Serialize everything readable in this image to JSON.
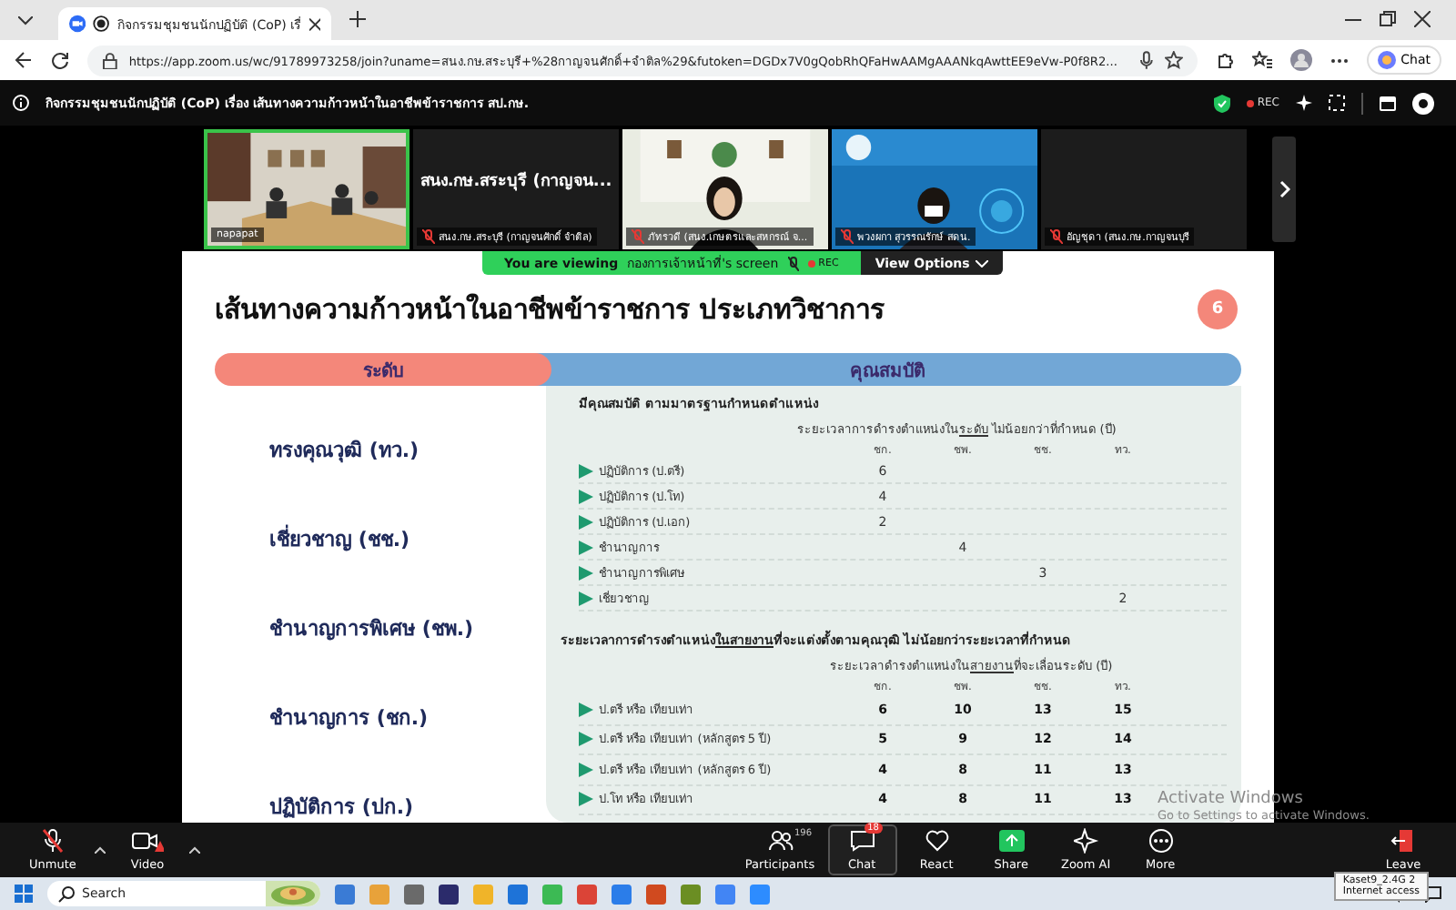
{
  "browser": {
    "tab_title": "กิจกรรมชุมชนนักปฏิบัติ (CoP) เรื่",
    "url": "https://app.zoom.us/wc/91789973258/join?uname=สนง.กษ.สระบุรี+%28กาญจนศักดิ์+จำติล%29&futoken=DGDx7V0gQobRhQFaHwAAMgAAANkqAwttEE9eVw-P0f8R2...",
    "chat_label": "Chat"
  },
  "meeting": {
    "title": "กิจกรรมชุมชนนักปฏิบัติ (CoP) เรื่อง เส้นทางความก้าวหน้าในอาชีพข้าราชการ สป.กษ.",
    "recording_label": "REC"
  },
  "participants": [
    {
      "name": "napapat",
      "muted": false,
      "active_speaker": true,
      "video": true
    },
    {
      "name": "สนง.กษ.สระบุรี (กาญจนศักดิ์ จำติล)",
      "display_name": "สนง.กษ.สระบุรี (กาญจน...",
      "muted": true,
      "active_speaker": false,
      "video": false
    },
    {
      "name": "ภัทรวดี (สนง.เกษตรและสหกรณ์ จ...",
      "muted": true,
      "active_speaker": false,
      "video": true
    },
    {
      "name": "พวงผกา สุวรรณรักษ์ สดน.",
      "muted": true,
      "active_speaker": false,
      "video": true
    },
    {
      "name": "อัญชุดา (สนง.กษ.กาญจนบุรี",
      "muted": true,
      "active_speaker": false,
      "video": false
    }
  ],
  "banner": {
    "prefix": "You are viewing",
    "sharer": "กองการเจ้าหน้าที่'s screen",
    "recording_label": "REC",
    "view_options": "View Options"
  },
  "slide": {
    "title": "เส้นทางความก้าวหน้าในอาชีพข้าราชการ ประเภทวิชาการ",
    "page_number": "6",
    "level_header": "ระดับ",
    "qualification_header": "คุณสมบัติ",
    "levels": [
      "ทรงคุณวุฒิ (ทว.)",
      "เชี่ยวชาญ (ชช.)",
      "ชำนาญการพิเศษ (ชพ.)",
      "ชำนาญการ (ชก.)",
      "ปฏิบัติการ (ปก.)"
    ],
    "sections": [
      {
        "heading": {
          "before": "มีคุณสมบัติ ตามมาตรฐานกำหนดตำแหน่ง"
        },
        "subheading": {
          "before": "ระยะเวลาการดำรงตำแหน่งใน",
          "underlined": "ระดับ",
          "after": " ไม่น้อยกว่าที่กำหนด (ปี)"
        },
        "columns": [
          "ชก.",
          "ชพ.",
          "ชช.",
          "ทว."
        ],
        "bold_values": false,
        "rows": [
          {
            "label": "ปฏิบัติการ (ป.ตรี)",
            "column_1": "6"
          },
          {
            "label": "ปฏิบัติการ (ป.โท)",
            "column_1": "4"
          },
          {
            "label": "ปฏิบัติการ (ป.เอก)",
            "column_1": "2"
          },
          {
            "label": "ชำนาญการ",
            "column_2": "4"
          },
          {
            "label": "ชำนาญการพิเศษ",
            "column_3": "3"
          },
          {
            "label": "เชี่ยวชาญ",
            "column_4": "2"
          }
        ]
      },
      {
        "heading": {
          "before": "ระยะเวลาการดำรงตำแหน่ง",
          "underlined": "ในสายงาน",
          "after": "ที่จะแต่งตั้งตามคุณวุฒิ ไม่น้อยกว่าระยะเวลาที่กำหนด"
        },
        "subheading": {
          "before": "ระยะเวลาดำรงตำแหน่งใน",
          "underlined": "สายงาน",
          "after": "ที่จะเลื่อนระดับ (ปี)"
        },
        "columns": [
          "ชก.",
          "ชพ.",
          "ชช.",
          "ทว."
        ],
        "bold_values": true,
        "rows": [
          {
            "label": "ป.ตรี หรือ เทียบเท่า",
            "column_1": "6",
            "column_2": "10",
            "column_3": "13",
            "column_4": "15"
          },
          {
            "label": "ป.ตรี หรือ เทียบเท่า (หลักสูตร 5 ปี)",
            "column_1": "5",
            "column_2": "9",
            "column_3": "12",
            "column_4": "14"
          },
          {
            "label": "ป.ตรี หรือ เทียบเท่า (หลักสูตร 6 ปี)",
            "column_1": "4",
            "column_2": "8",
            "column_3": "11",
            "column_4": "13"
          },
          {
            "label": "ป.โท หรือ เทียบเท่า",
            "column_1": "4",
            "column_2": "8",
            "column_3": "11",
            "column_4": "13"
          }
        ]
      }
    ]
  },
  "os_notice": [
    "Activate Windows",
    "Go to Settings to activate Windows."
  ],
  "toolbar": [
    {
      "kind": "mic",
      "label": "Unmute"
    },
    {
      "kind": "video",
      "label": "Video"
    },
    {
      "kind": "participants",
      "label": "Participants",
      "count": "196"
    },
    {
      "kind": "chat",
      "label": "Chat",
      "badge": "18"
    },
    {
      "kind": "react",
      "label": "React"
    },
    {
      "kind": "share",
      "label": "Share"
    },
    {
      "kind": "ai",
      "label": "Zoom AI"
    },
    {
      "kind": "more",
      "label": "More"
    },
    {
      "kind": "leave",
      "label": "Leave"
    }
  ],
  "taskbar": {
    "search_placeholder": "Search",
    "tooltip": [
      "Kaset9_2.4G 2",
      "Internet access"
    ]
  }
}
